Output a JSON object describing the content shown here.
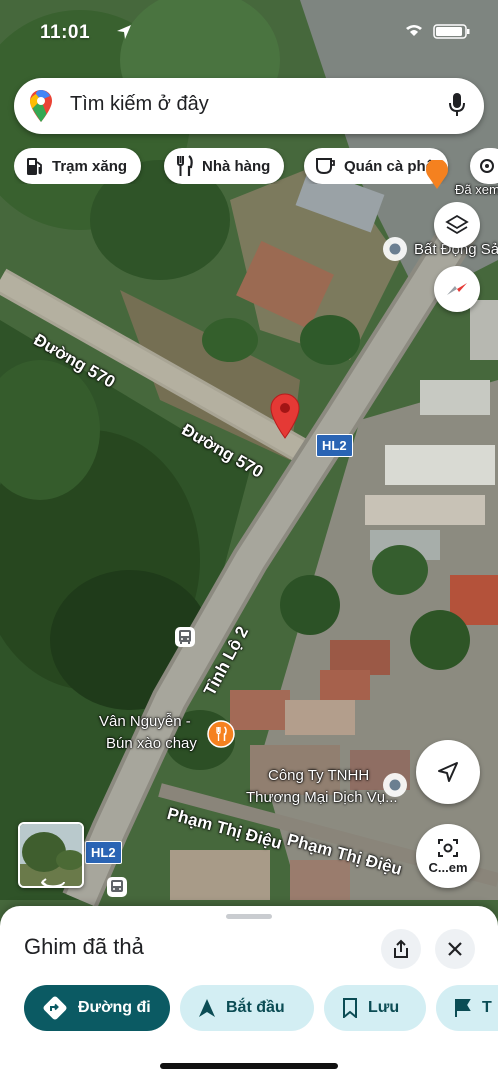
{
  "status_bar": {
    "time": "11:01"
  },
  "search": {
    "placeholder": "Tìm kiếm ở đây"
  },
  "chips": [
    {
      "label": "Trạm xăng",
      "icon": "gas-station-icon"
    },
    {
      "label": "Nhà hàng",
      "icon": "restaurant-icon"
    },
    {
      "label": "Quán cà phê",
      "icon": "coffee-icon"
    }
  ],
  "map": {
    "labels": {
      "road_570_a": "Đường 570",
      "road_570_b": "Đường 570",
      "provincial_road": "Tỉnh Lộ 2",
      "pham_thi_dieu": "Phạm Thị Điệu",
      "pham_thi_dieu_2": "Phạm Thị Điệu",
      "place_top_partial": "Đã xem",
      "bat_dong_san": "Bất Động Sả",
      "restaurant_line1": "Vân Nguyễn -",
      "restaurant_line2": "Bún xào chay",
      "company_line1": "Công Ty TNHH",
      "company_line2": "Thương Mại Dịch Vụ...",
      "road_badge_1": "HL2",
      "road_badge_2": "HL2",
      "street_view_btn": "C...em"
    }
  },
  "sheet": {
    "title": "Ghim đã thả",
    "actions": [
      {
        "label": "Đường đi",
        "icon": "directions-icon"
      },
      {
        "label": "Bắt đầu",
        "icon": "navigation-arrow-icon"
      },
      {
        "label": "Lưu",
        "icon": "bookmark-icon"
      },
      {
        "label": "T",
        "icon": "flag-icon"
      }
    ]
  },
  "colors": {
    "pin": "#e53935",
    "primary_action": "#0b5a63",
    "secondary_action": "#d3eef3",
    "road_badge": "#2a64b4"
  }
}
